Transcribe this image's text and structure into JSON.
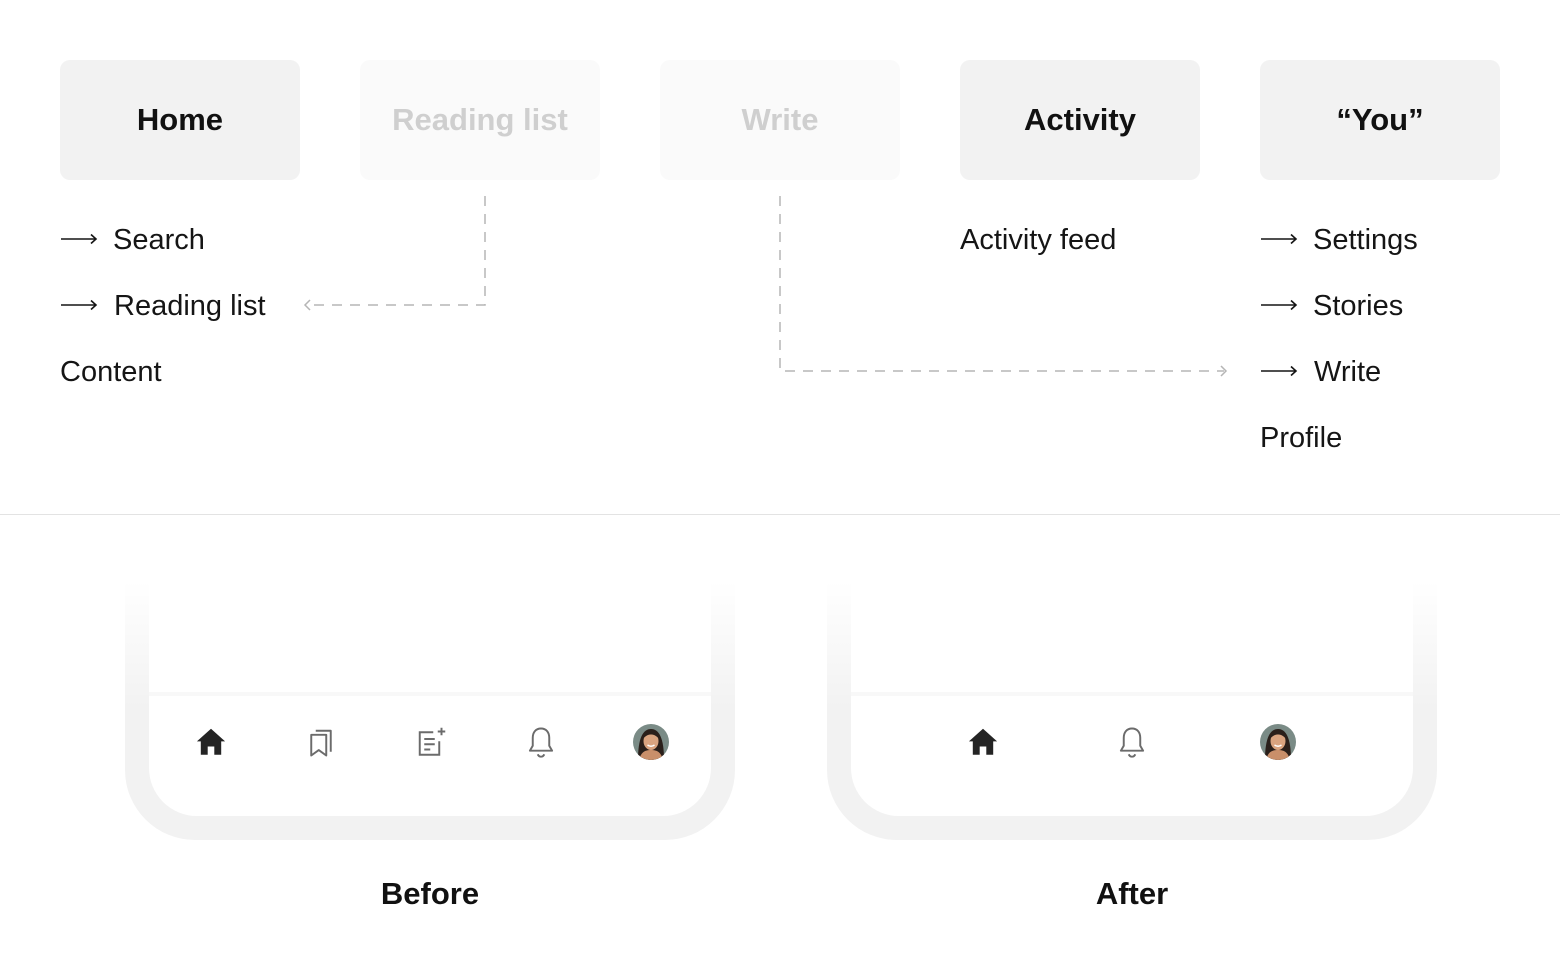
{
  "tabs": {
    "home": "Home",
    "reading_list": "Reading list",
    "write": "Write",
    "activity": "Activity",
    "you": "“You”"
  },
  "home_items": {
    "search": "Search",
    "reading_list": "Reading list",
    "content": "Content"
  },
  "activity_items": {
    "feed": "Activity feed"
  },
  "you_items": {
    "settings": "Settings",
    "stories": "Stories",
    "write": "Write",
    "profile": "Profile"
  },
  "captions": {
    "before": "Before",
    "after": "After"
  },
  "nav_before_icons": [
    "home-icon",
    "reading-list-icon",
    "write-icon",
    "bell-icon",
    "avatar"
  ],
  "nav_after_icons": [
    "home-icon",
    "bell-icon",
    "avatar"
  ],
  "colors": {
    "card_bg": "#f2f2f2",
    "faded_text": "#cfcfcf",
    "connector": "#b5b5b5",
    "icon_dark": "#242424",
    "icon_gray": "#6b6b6b"
  }
}
